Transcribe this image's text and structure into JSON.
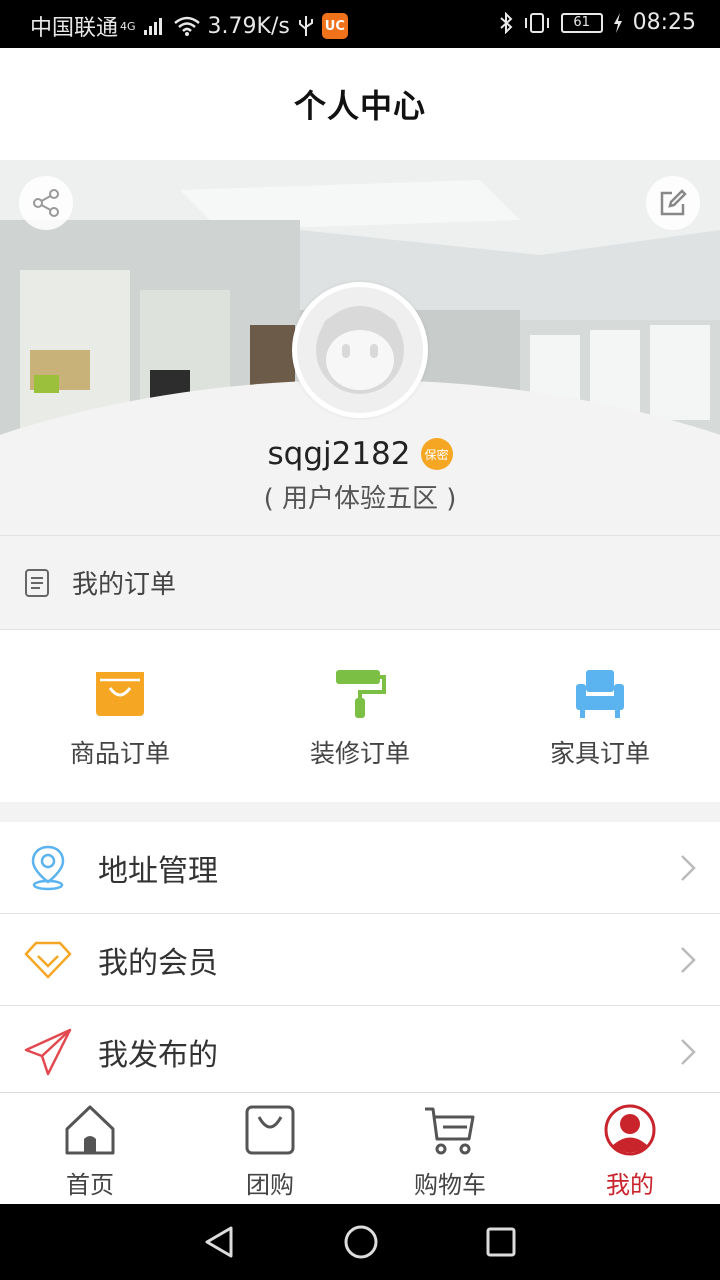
{
  "status_bar": {
    "carrier": "中国联通",
    "network": "4G",
    "speed": "3.79K/s",
    "battery": "61",
    "time": "08:25",
    "app_badge": "UC"
  },
  "title_bar": {
    "title": "个人中心"
  },
  "profile": {
    "username": "sqgj2182",
    "secret_badge": "保密",
    "zone": "( 用户体验五区 )"
  },
  "orders": {
    "label": "我的订单",
    "categories": [
      {
        "label": "商品订单",
        "icon": "shopping-bag-icon",
        "color": "#f5a623"
      },
      {
        "label": "装修订单",
        "icon": "paint-roller-icon",
        "color": "#7cbf45"
      },
      {
        "label": "家具订单",
        "icon": "armchair-icon",
        "color": "#5bb3f0"
      }
    ]
  },
  "menu": [
    {
      "label": "地址管理",
      "icon": "location-pin-icon"
    },
    {
      "label": "我的会员",
      "icon": "diamond-icon"
    },
    {
      "label": "我发布的",
      "icon": "paper-plane-icon"
    }
  ],
  "bottom_nav": [
    {
      "label": "首页",
      "icon": "home-icon"
    },
    {
      "label": "团购",
      "icon": "shopping-bag-icon"
    },
    {
      "label": "购物车",
      "icon": "cart-icon"
    },
    {
      "label": "我的",
      "icon": "user-icon",
      "active": true
    }
  ],
  "colors": {
    "accent": "#c9242b",
    "orange": "#f5a623",
    "green": "#7cbf45",
    "blue": "#5bb3f0"
  }
}
